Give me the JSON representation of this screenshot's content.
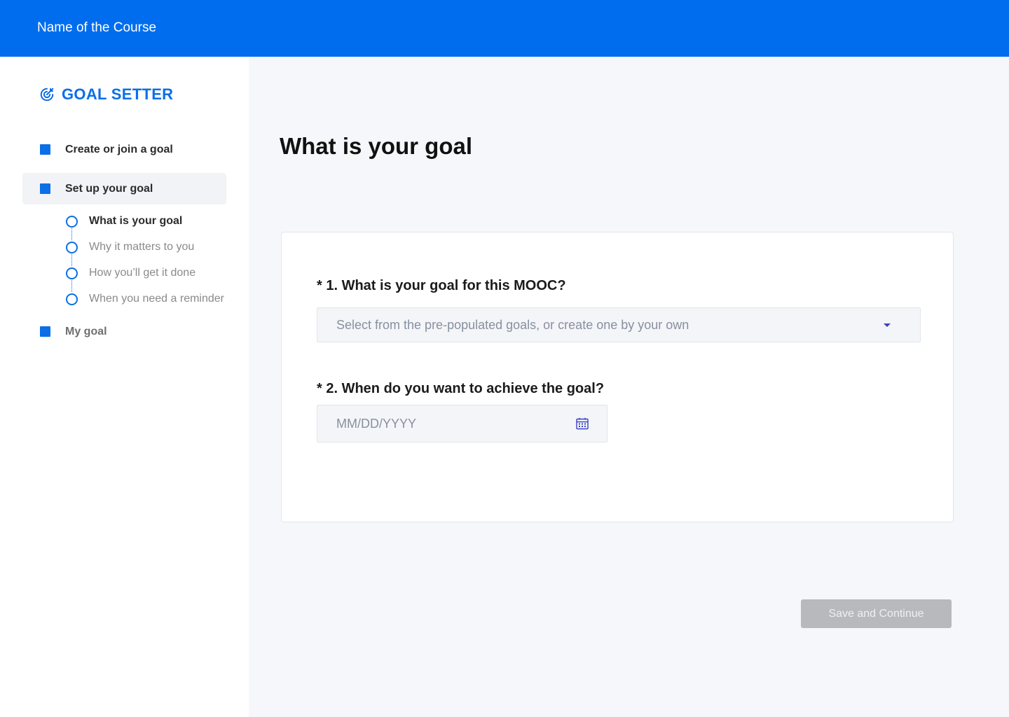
{
  "header": {
    "course_name": "Name of the Course"
  },
  "sidebar": {
    "brand": {
      "icon": "target-icon",
      "title": "GOAL SETTER"
    },
    "items": [
      {
        "label": "Create or join a goal",
        "state": "default"
      },
      {
        "label": "Set up your goal",
        "state": "active"
      },
      {
        "label": "My goal",
        "state": "muted"
      }
    ],
    "sub_steps": [
      {
        "label": "What is your goal",
        "current": true
      },
      {
        "label": "Why it matters to you",
        "current": false
      },
      {
        "label": "How you’ll get it done",
        "current": false
      },
      {
        "label": "When you need a reminder",
        "current": false
      }
    ]
  },
  "main": {
    "title": "What is your goal",
    "questions": [
      {
        "label": "* 1. What is your goal for this MOOC?",
        "placeholder": "Select from the pre-populated goals, or create one by your own",
        "control": "dropdown"
      },
      {
        "label": "* 2. When do you want to achieve the goal?",
        "placeholder": "MM/DD/YYYY",
        "control": "date"
      }
    ],
    "save_label": "Save and Continue"
  },
  "colors": {
    "primary": "#006def",
    "accent": "#0b6fe6",
    "button_disabled": "#b7b9bd"
  }
}
